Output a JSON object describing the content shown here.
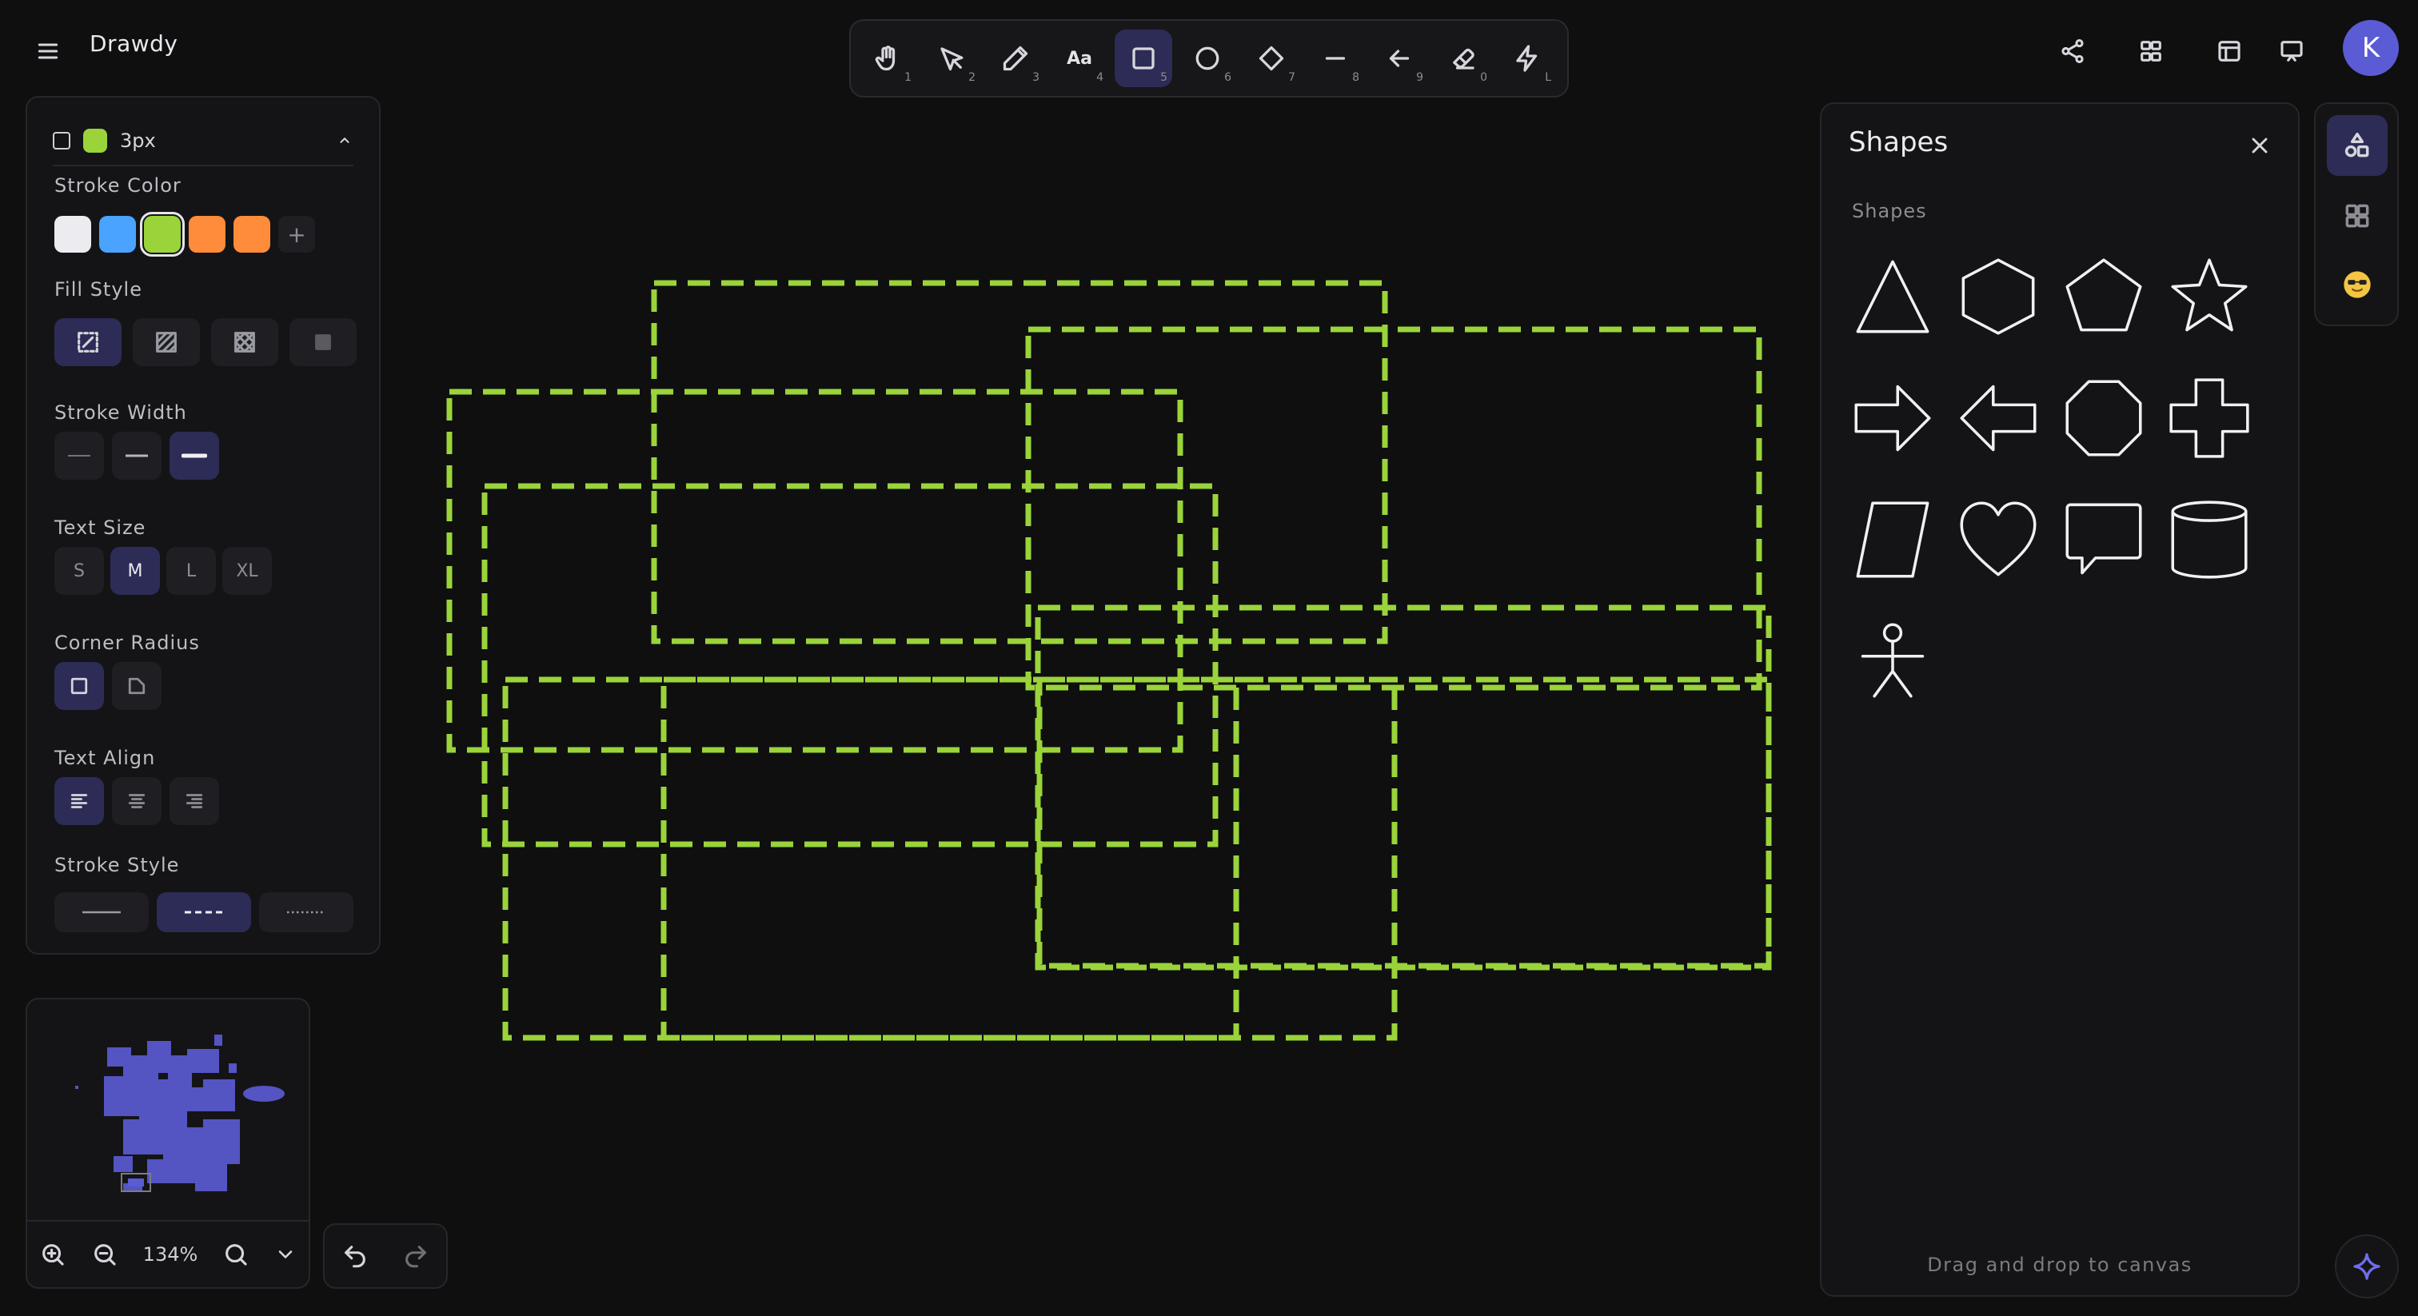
{
  "app": {
    "title": "Drawdy"
  },
  "toolbar": {
    "tools": [
      {
        "name": "hand",
        "hotkey": "1"
      },
      {
        "name": "select",
        "hotkey": "2"
      },
      {
        "name": "pencil",
        "hotkey": "3"
      },
      {
        "name": "text",
        "label": "Aa",
        "hotkey": "4"
      },
      {
        "name": "rectangle",
        "hotkey": "5",
        "active": true
      },
      {
        "name": "ellipse",
        "hotkey": "6"
      },
      {
        "name": "diamond",
        "hotkey": "7"
      },
      {
        "name": "line",
        "hotkey": "8"
      },
      {
        "name": "arrow",
        "hotkey": "9"
      },
      {
        "name": "eraser",
        "hotkey": "0"
      },
      {
        "name": "laser",
        "hotkey": "L"
      }
    ]
  },
  "header": {
    "avatar_initial": "K"
  },
  "props": {
    "summary": {
      "stroke_width_label": "3px",
      "color": "#9ad43a"
    },
    "stroke_color": {
      "label": "Stroke Color",
      "swatches": [
        "#ececf0",
        "#4aa3ff",
        "#9ad43a",
        "#ff8c3a",
        "#ff8c3a"
      ],
      "selected": 2,
      "add": "+"
    },
    "fill_style": {
      "label": "Fill Style"
    },
    "stroke_width": {
      "label": "Stroke Width"
    },
    "text_size": {
      "label": "Text Size",
      "options": [
        "S",
        "M",
        "L",
        "XL"
      ],
      "selected": "M"
    },
    "corner_radius": {
      "label": "Corner Radius"
    },
    "text_align": {
      "label": "Text Align"
    },
    "stroke_style": {
      "label": "Stroke Style",
      "selected": "dashed"
    }
  },
  "zoom": {
    "level": "134%"
  },
  "shapes_panel": {
    "title": "Shapes",
    "section": "Shapes",
    "footer": "Drag and drop to canvas",
    "items": [
      "triangle",
      "hexagon",
      "pentagon",
      "star",
      "arrow-right",
      "arrow-left",
      "octagon",
      "cross",
      "parallelogram",
      "heart",
      "speech-bubble",
      "cylinder",
      "stick-figure"
    ]
  },
  "canvas": {
    "stroke_color": "#9ad43a",
    "stroke_style": "dashed",
    "shape_count": 8
  }
}
